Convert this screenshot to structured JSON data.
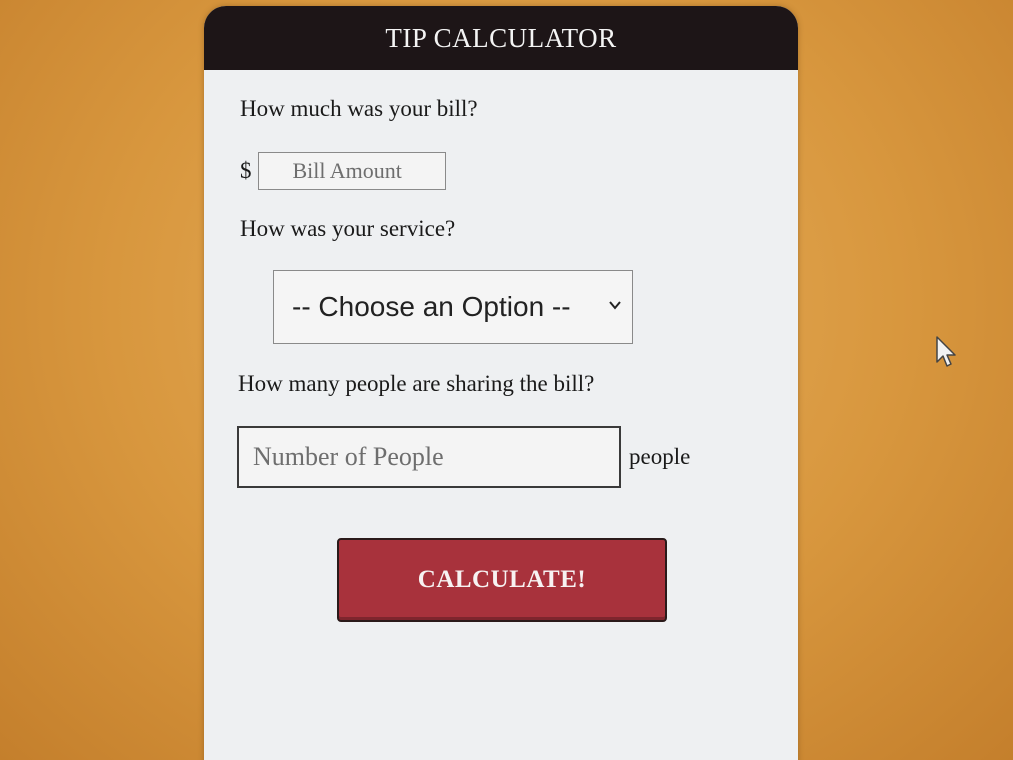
{
  "header": {
    "title": "TIP CALCULATOR"
  },
  "bill": {
    "question": "How much was your bill?",
    "currency_symbol": "$",
    "placeholder": "Bill Amount",
    "value": ""
  },
  "service": {
    "question": "How was your service?",
    "selected_option": "-- Choose an Option --",
    "icon": "chevron-down-icon"
  },
  "people": {
    "question": "How many people are sharing the bill?",
    "placeholder": "Number of People",
    "value": "",
    "unit_label": "people"
  },
  "actions": {
    "calculate_label": "CALCULATE!"
  },
  "colors": {
    "header_bg": "#1d1517",
    "button_bg": "#a8323c",
    "page_bg": "#d8973e",
    "card_bg": "#eef0f2"
  }
}
